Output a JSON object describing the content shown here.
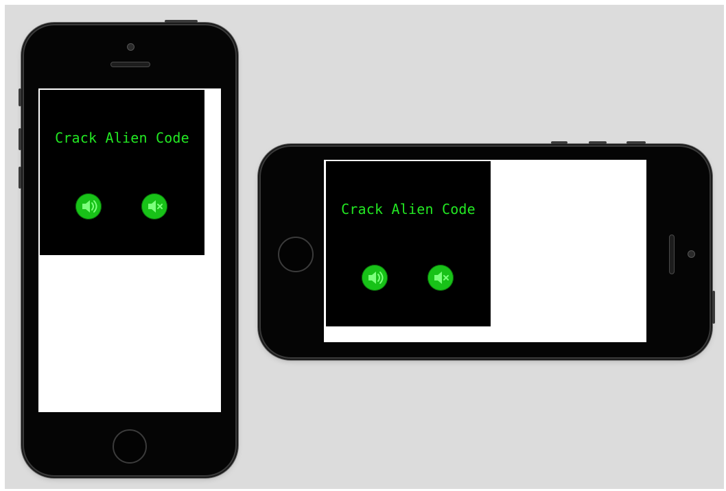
{
  "app": {
    "title": "Crack Alien Code"
  },
  "portrait": {
    "title": "Crack Alien Code",
    "sound_on_icon": "speaker-on-icon",
    "sound_off_icon": "speaker-muted-icon"
  },
  "landscape": {
    "title": "Crack Alien Code",
    "sound_on_icon": "speaker-on-icon",
    "sound_off_icon": "speaker-muted-icon"
  },
  "colors": {
    "background": "#dcdcdc",
    "phone_body": "#050505",
    "screen": "#ffffff",
    "game_view": "#000000",
    "accent_green": "#23e823",
    "button_green": "#18c218"
  }
}
